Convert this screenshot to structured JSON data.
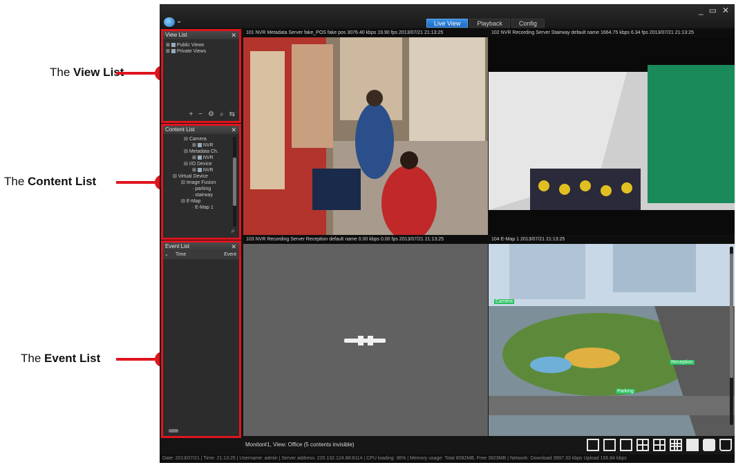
{
  "callouts": [
    {
      "prefix": "The ",
      "bold": "View List"
    },
    {
      "prefix": "The ",
      "bold": "Content List"
    },
    {
      "prefix": "The ",
      "bold": "Event List"
    }
  ],
  "titlebar": {
    "tabs": [
      "Live View",
      "Playback",
      "Config"
    ],
    "active_tab": "Live View",
    "window_controls": [
      "_",
      "▭",
      "✕"
    ]
  },
  "view_list": {
    "title": "View List",
    "items": [
      "Public Views",
      "Private Views"
    ]
  },
  "content_list": {
    "title": "Content List",
    "items": [
      "Camera",
      "NVR",
      "Metadata Ch.",
      "NVR",
      "I/O Device",
      "NVR",
      "Virtual Device",
      "Image Fusion",
      "parking",
      "stairway",
      "E-Map",
      "E-Map 1"
    ]
  },
  "event_list": {
    "title": "Event List",
    "columns": [
      "Time",
      "Event"
    ]
  },
  "tiles": [
    {
      "header": "101 NVR Metadata Server fake_POS fake pos  3076.40 kbps  19.90 fps  2013/07/21  21:13:25"
    },
    {
      "header": "102 NVR Recording Server Stairway default name  1664.75 kbps  6.34 fps  2013/07/21  21:13:25"
    },
    {
      "header": "103 NVR Recording Server Reception default name  0.00 kbps  0.00 fps  2013/07/21  21:13:25"
    },
    {
      "header": "104 E-Map 1  2013/07/21  21:13:25"
    }
  ],
  "map_labels": [
    "Camera",
    "Parking",
    "Reception"
  ],
  "bottom": {
    "monitor_text": "Monitor#1, View: Office (5 contents invisible)"
  },
  "status": {
    "text": "Date: 2013/07/21  |  Time: 21:13:25  |  Username: admin  |  Server address: 220.132.124.88:8114  |  CPU loading: 36%  |  Memory usage: Total 8092MB, Free 3923MB  |  Network: Download 3997.33 kbps  Upload 156.84 kbps"
  },
  "colors": {
    "accent_red": "#e0141e",
    "tab_active": "#2f7fd6",
    "app_bg": "#141414"
  }
}
